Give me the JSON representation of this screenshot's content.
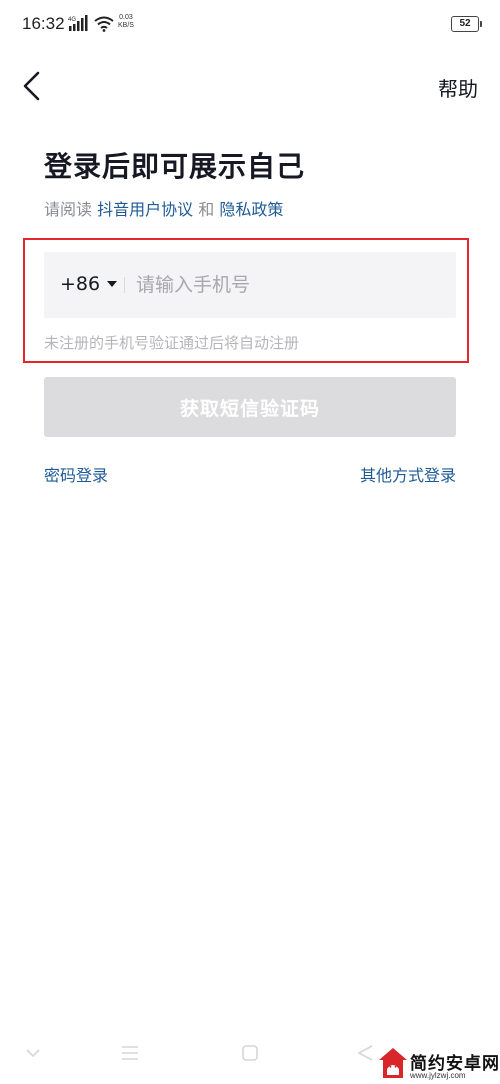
{
  "status_bar": {
    "time": "16:32",
    "net_speed_value": "0.03",
    "net_speed_unit": "KB/S",
    "battery": "52",
    "signal_label": "4G",
    "icons": [
      "signal-icon",
      "wifi-icon",
      "battery-icon"
    ]
  },
  "nav": {
    "back_icon": "chevron-left-icon",
    "help_label": "帮助"
  },
  "login": {
    "title": "登录后即可展示自己",
    "agreement_prefix": "请阅读",
    "agreement_link_user": "抖音用户协议",
    "agreement_and": "和",
    "agreement_link_privacy": "隐私政策",
    "country_code": "+86",
    "phone_placeholder": "请输入手机号",
    "phone_value": "",
    "hint": "未注册的手机号验证通过后将自动注册",
    "sms_button_label": "获取短信验证码",
    "password_login_label": "密码登录",
    "other_login_label": "其他方式登录"
  },
  "bottom_nav": {
    "icons": [
      "chevron-down-icon",
      "menu-icon",
      "square-icon",
      "back-triangle-icon"
    ]
  },
  "watermark": {
    "name": "简约安卓网",
    "url": "www.jylzwj.com"
  },
  "colors": {
    "link": "#1f5a96",
    "highlight_border": "#e5272d",
    "button_disabled": "#dcdcde",
    "input_bg": "#f4f4f6"
  }
}
